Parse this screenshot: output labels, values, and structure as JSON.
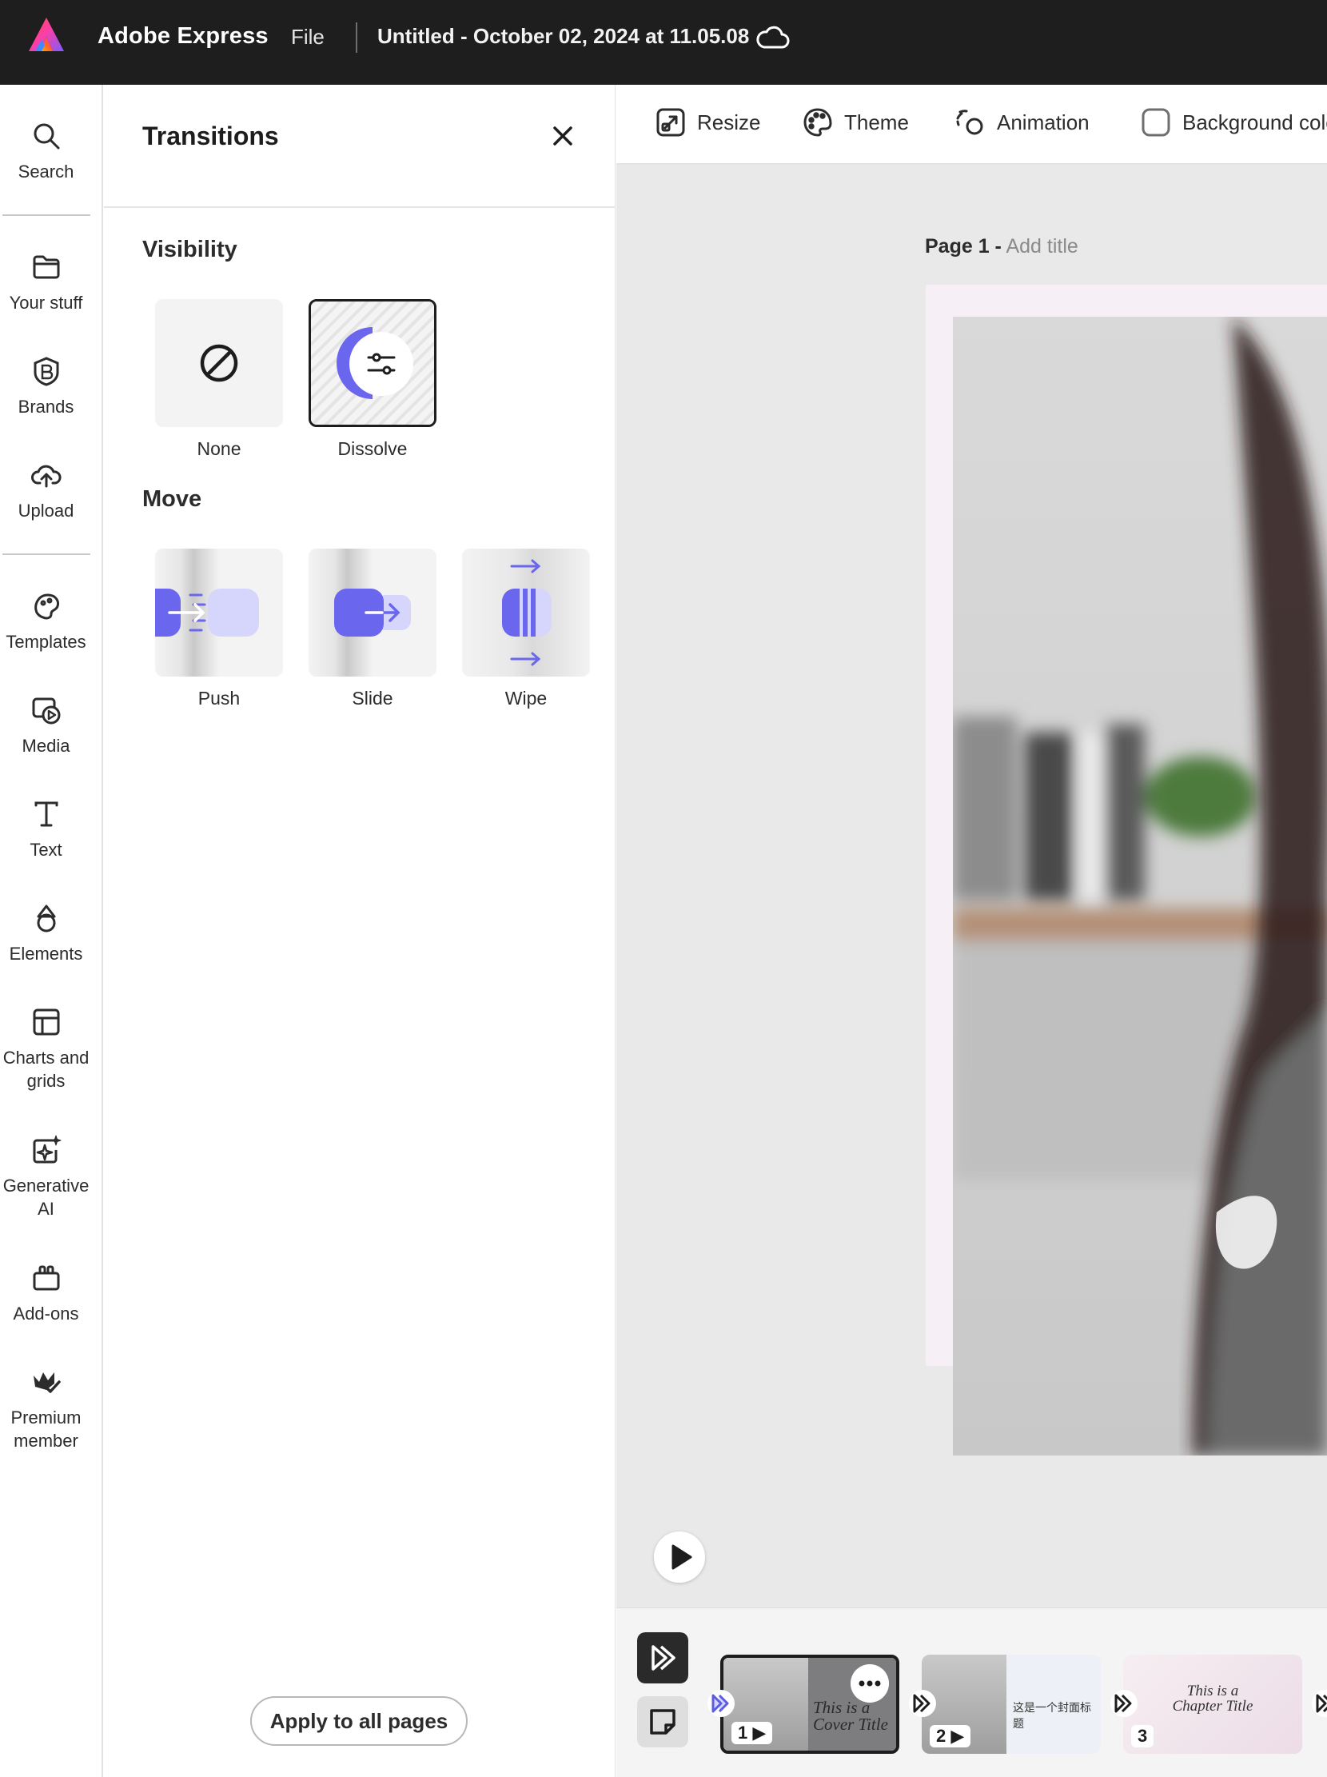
{
  "header": {
    "app_name": "Adobe Express",
    "file_menu": "File",
    "document_title": "Untitled - October 02, 2024 at 11.05.08"
  },
  "rail": {
    "items": [
      {
        "label": "Search",
        "icon": "search-icon"
      },
      {
        "label": "Your stuff",
        "icon": "folder-icon"
      },
      {
        "label": "Brands",
        "icon": "brand-icon"
      },
      {
        "label": "Upload",
        "icon": "upload-cloud-icon"
      },
      {
        "label": "Templates",
        "icon": "templates-icon"
      },
      {
        "label": "Media",
        "icon": "media-icon"
      },
      {
        "label": "Text",
        "icon": "text-icon"
      },
      {
        "label": "Elements",
        "icon": "elements-icon"
      },
      {
        "label": "Charts and grids",
        "icon": "charts-grids-icon"
      },
      {
        "label": "Generative AI",
        "icon": "generative-ai-icon"
      },
      {
        "label": "Add-ons",
        "icon": "add-ons-icon"
      },
      {
        "label": "Premium member",
        "icon": "premium-crown-icon"
      }
    ]
  },
  "panel": {
    "title": "Transitions",
    "visibility": {
      "heading": "Visibility",
      "options": [
        {
          "label": "None",
          "selected": false
        },
        {
          "label": "Dissolve",
          "selected": true
        }
      ]
    },
    "move": {
      "heading": "Move",
      "options": [
        {
          "label": "Push"
        },
        {
          "label": "Slide"
        },
        {
          "label": "Wipe"
        }
      ]
    },
    "apply_button": "Apply to all pages"
  },
  "toolbar": {
    "resize": "Resize",
    "theme": "Theme",
    "animation": "Animation",
    "background_color": "Background colo"
  },
  "canvas": {
    "page_prefix": "Page 1 -",
    "page_title_placeholder": "Add title"
  },
  "filmstrip": {
    "slides": [
      {
        "number": "1",
        "title_line1": "This is a",
        "title_line2": "Cover Title",
        "active": true
      },
      {
        "number": "2",
        "title": "这是一个封面标题",
        "active": false
      },
      {
        "number": "3",
        "title_line1": "This is a",
        "title_line2": "Chapter Title",
        "active": false
      }
    ]
  },
  "colors": {
    "accent": "#5c5ce0",
    "accent_light": "#d4d3fb",
    "topbar": "#1e1e1e"
  }
}
